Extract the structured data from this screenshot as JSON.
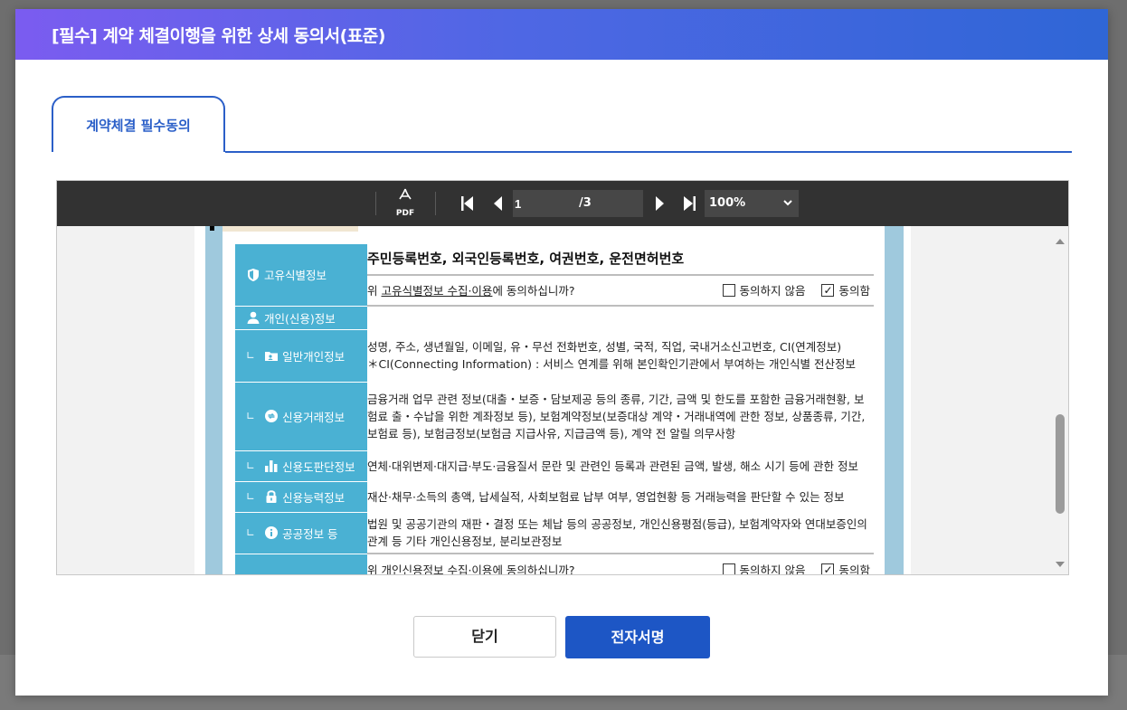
{
  "modal": {
    "title": "[필수] 계약 체결이행을 위한 상세 동의서(표준)"
  },
  "tabs": [
    {
      "label": "계약체결 필수동의"
    }
  ],
  "viewer": {
    "pdf_label": "PDF",
    "page_current": "1",
    "page_total": "/3",
    "zoom": "100%"
  },
  "table": {
    "unique_id": {
      "label": "고유식별정보",
      "heading": "주민등록번호, 외국인등록번호, 여권번호, 운전면허번호",
      "question_prefix": "위 ",
      "question_link": "고유식별정보 수집·이용",
      "question_suffix": "에 동의하십니까?",
      "disagree": "동의하지 않음",
      "agree": "동의함"
    },
    "personal_label": "개인(신용)정보",
    "rows": [
      {
        "label": "일반개인정보",
        "icon": "id-card-icon",
        "text1": "성명, 주소, 생년월일, 이메일, 유・무선 전화번호, 성별, 국적, 직업, 국내거소신고번호, CI(연계정보)",
        "text2": "＊CI(Connecting Information) : 서비스 연계를 위해 본인확인기관에서 부여하는 개인식별 전산정보"
      },
      {
        "label": "신용거래정보",
        "icon": "exchange-icon",
        "text1": "금융거래 업무 관련 정보(대출・보증・담보제공 등의 종류, 기간, 금액 및 한도를 포함한 금융거래현황, 보험료 출・수납을 위한 계좌정보 등), 보험계약정보(보증대상 계약・거래내역에 관한 정보, 상품종류, 기간, 보험료 등), 보험금정보(보험금 지급사유, 지급금액 등), 계약 전 알릴 의무사항"
      },
      {
        "label": "신용도판단정보",
        "icon": "bar-chart-icon",
        "text1": "연체·대위변제·대지급·부도·금융질서 문란 및 관련인 등록과 관련된 금액, 발생, 해소 시기 등에 관한 정보"
      },
      {
        "label": "신용능력정보",
        "icon": "lock-icon",
        "text1": "재산·채무·소득의 총액, 납세실적, 사회보험료 납부 여부, 영업현황 등 거래능력을 판단할 수 있는 정보"
      },
      {
        "label": "공공정보 등",
        "icon": "info-icon",
        "text1": "법원 및 공공기관의 재판・결정 또는 체납 등의 공공정보, 개인신용평점(등급), 보험계약자와 연대보증인의 관계 등 기타 개인신용정보, 분리보관정보"
      }
    ],
    "personal_question": {
      "prefix": "위 ",
      "link": "개인신용정보 수집·이용",
      "suffix": "에 동의하십니까?",
      "disagree": "동의하지 않음",
      "agree": "동의함"
    }
  },
  "buttons": {
    "close": "닫기",
    "sign": "전자서명"
  },
  "colors": {
    "header_start": "#7b5cf0",
    "header_end": "#2f66d6",
    "accent": "#2b5fc8",
    "primary_button": "#1d56c5",
    "label_cell": "#4ab1d3"
  }
}
